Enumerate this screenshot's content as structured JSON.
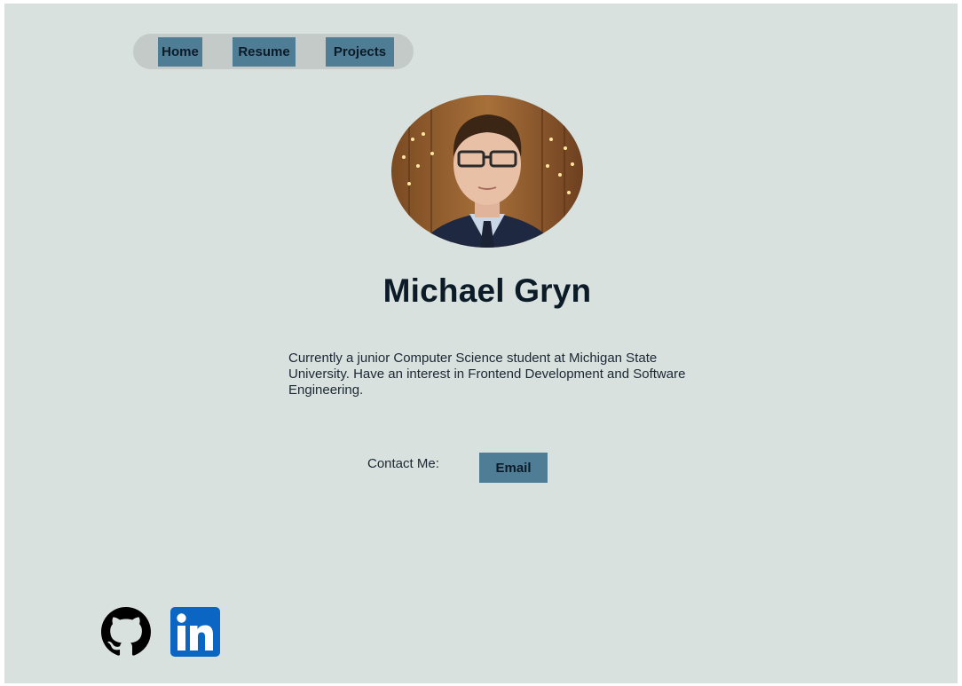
{
  "nav": {
    "home_label": "Home",
    "resume_label": "Resume",
    "projects_label": "Projects"
  },
  "profile": {
    "name": "Michael Gryn",
    "bio": "Currently a junior Computer Science student at Michigan State University. Have an interest in Frontend Development and Software Engineering."
  },
  "contact": {
    "label": "Contact Me:",
    "email_label": "Email"
  },
  "social": {
    "github_icon": "github-icon",
    "linkedin_icon": "linkedin-icon"
  },
  "colors": {
    "background": "#d9e1df",
    "nav_pill": "#c3cac8",
    "button": "#4f7d96",
    "text_dark": "#0c1b28",
    "linkedin_blue": "#0a66c2"
  }
}
